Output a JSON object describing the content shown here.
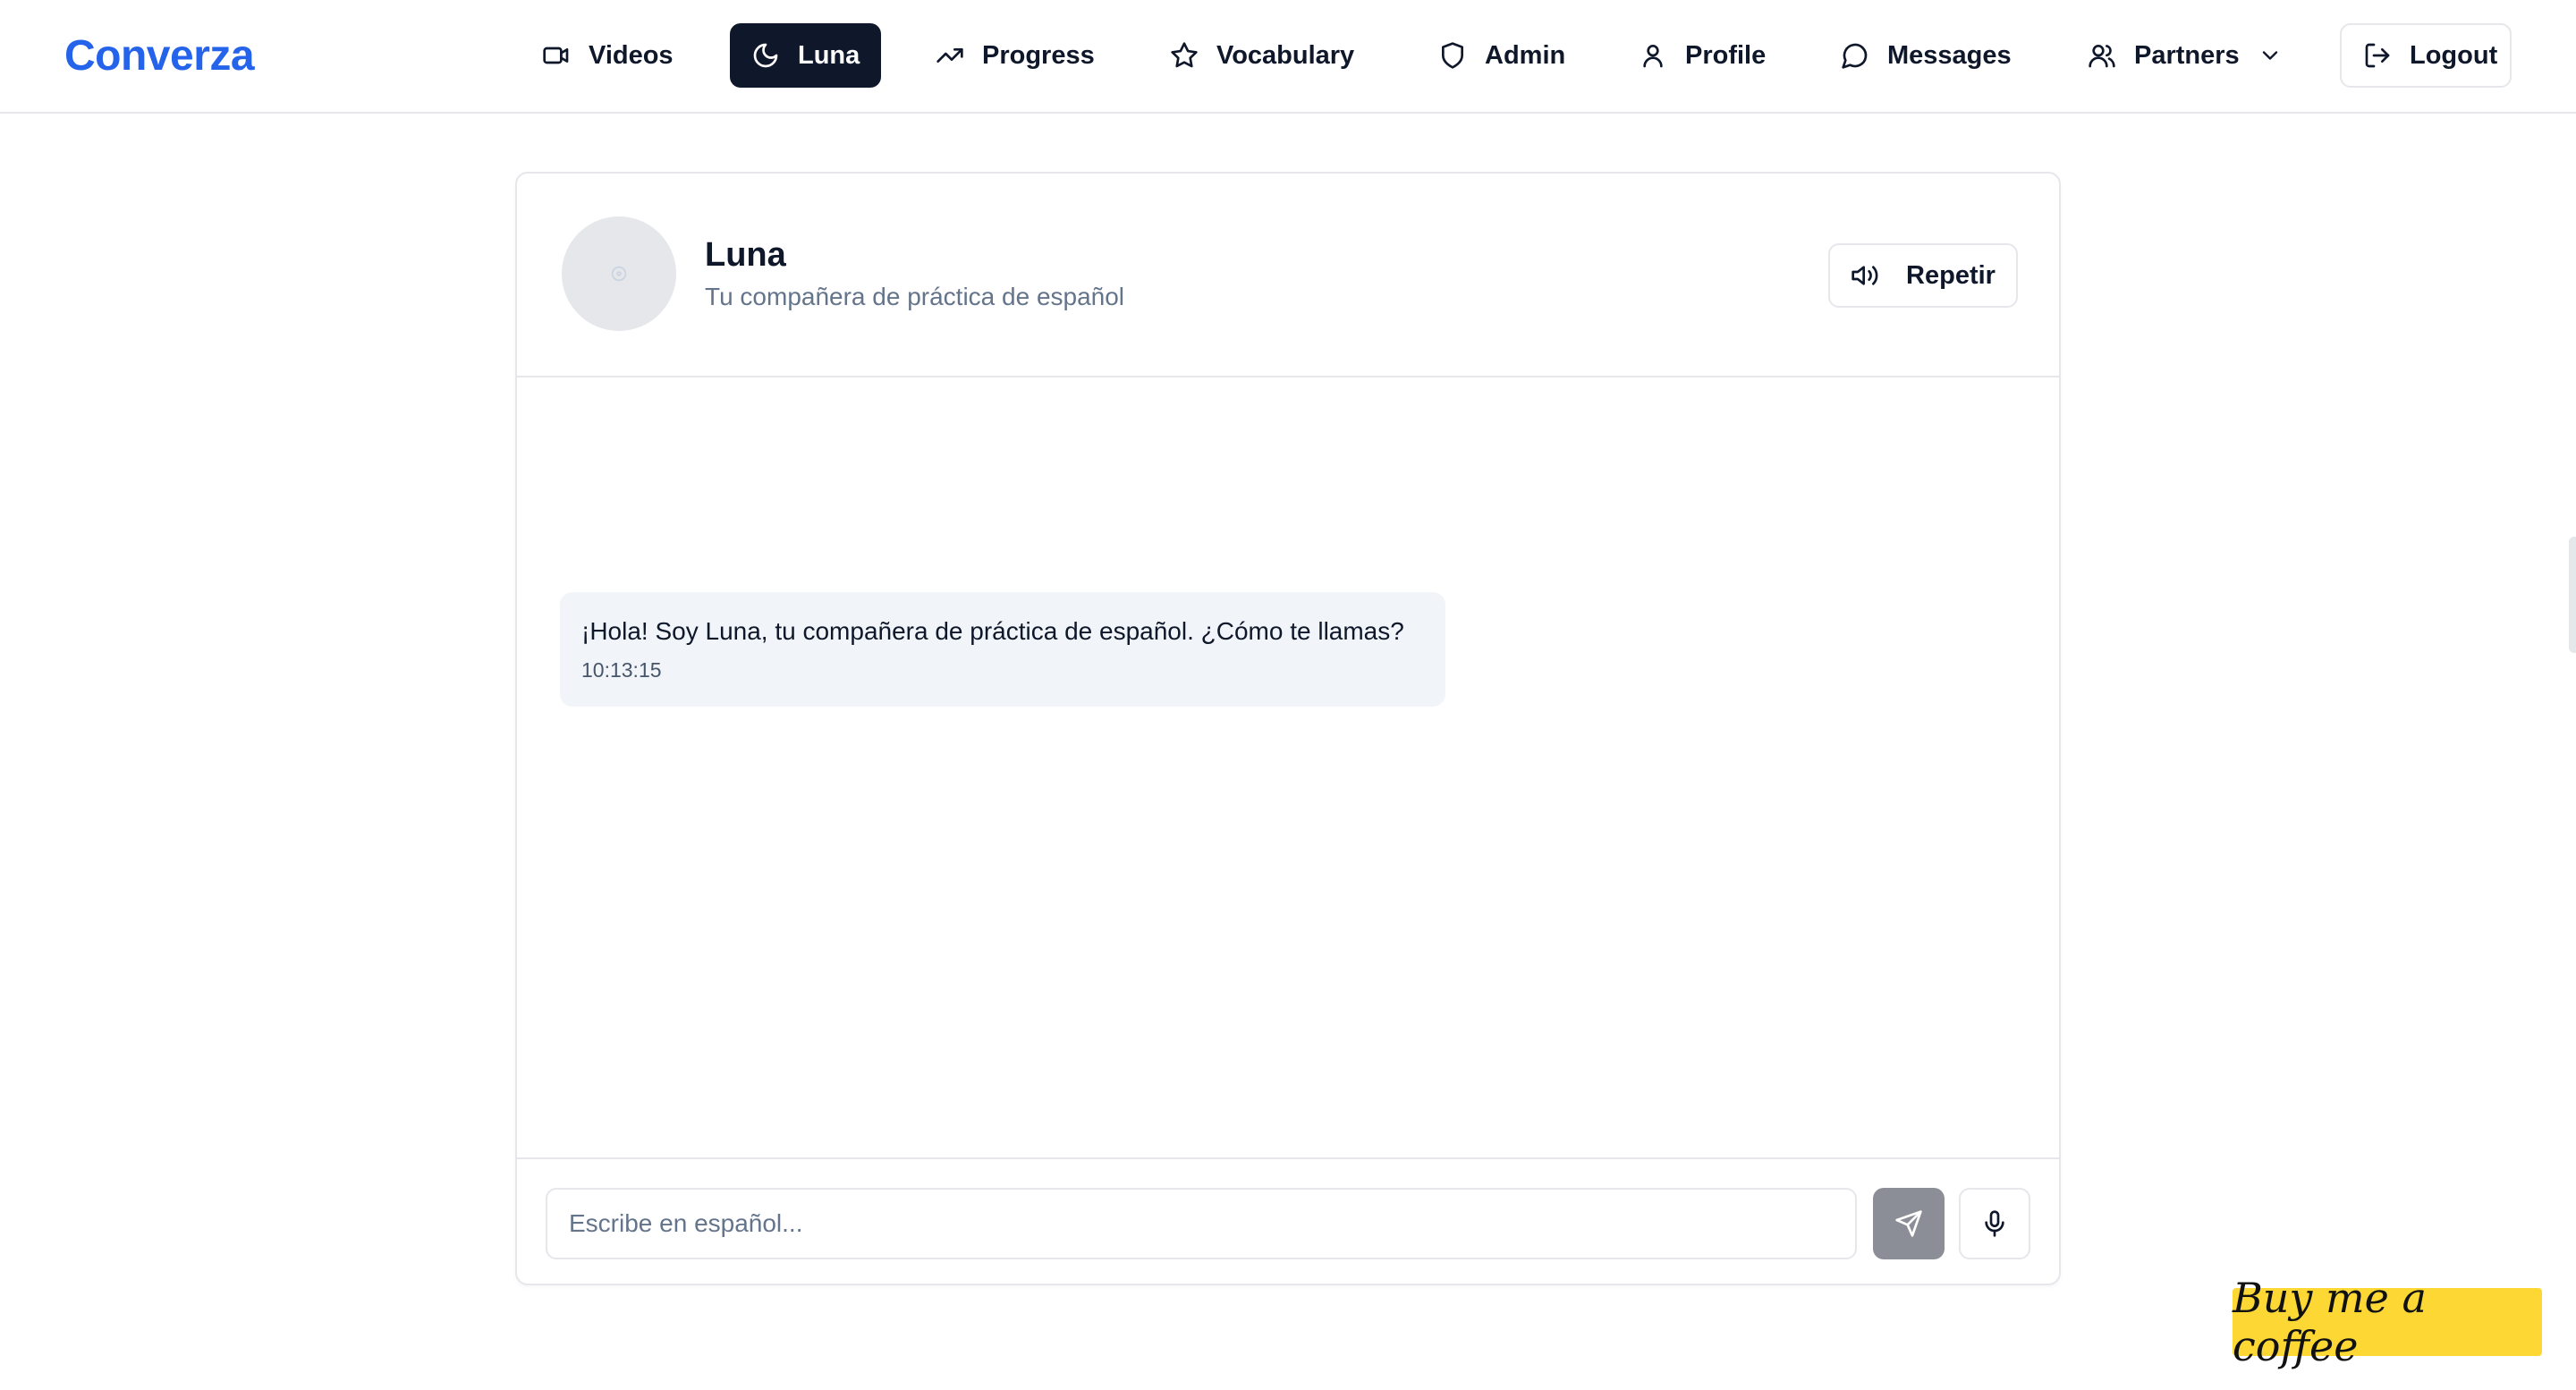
{
  "brand": "Converza",
  "nav": {
    "videos": "Videos",
    "luna": "Luna",
    "progress": "Progress",
    "vocabulary": "Vocabulary",
    "admin": "Admin",
    "profile": "Profile",
    "messages": "Messages",
    "partners": "Partners",
    "logout": "Logout"
  },
  "chat": {
    "name": "Luna",
    "subtitle": "Tu compañera de práctica de español",
    "repeat_label": "Repetir",
    "messages": [
      {
        "text": "¡Hola! Soy Luna, tu compañera de práctica de español. ¿Cómo te llamas?",
        "time": "10:13:15"
      }
    ],
    "input_placeholder": "Escribe en español..."
  },
  "coffee_label": "Buy me a coffee",
  "colors": {
    "brand": "#2563eb",
    "active_nav": "#0f172a",
    "send_button": "#8b8e96",
    "coffee_badge": "#fdd835",
    "bubble": "#f1f5f9"
  }
}
